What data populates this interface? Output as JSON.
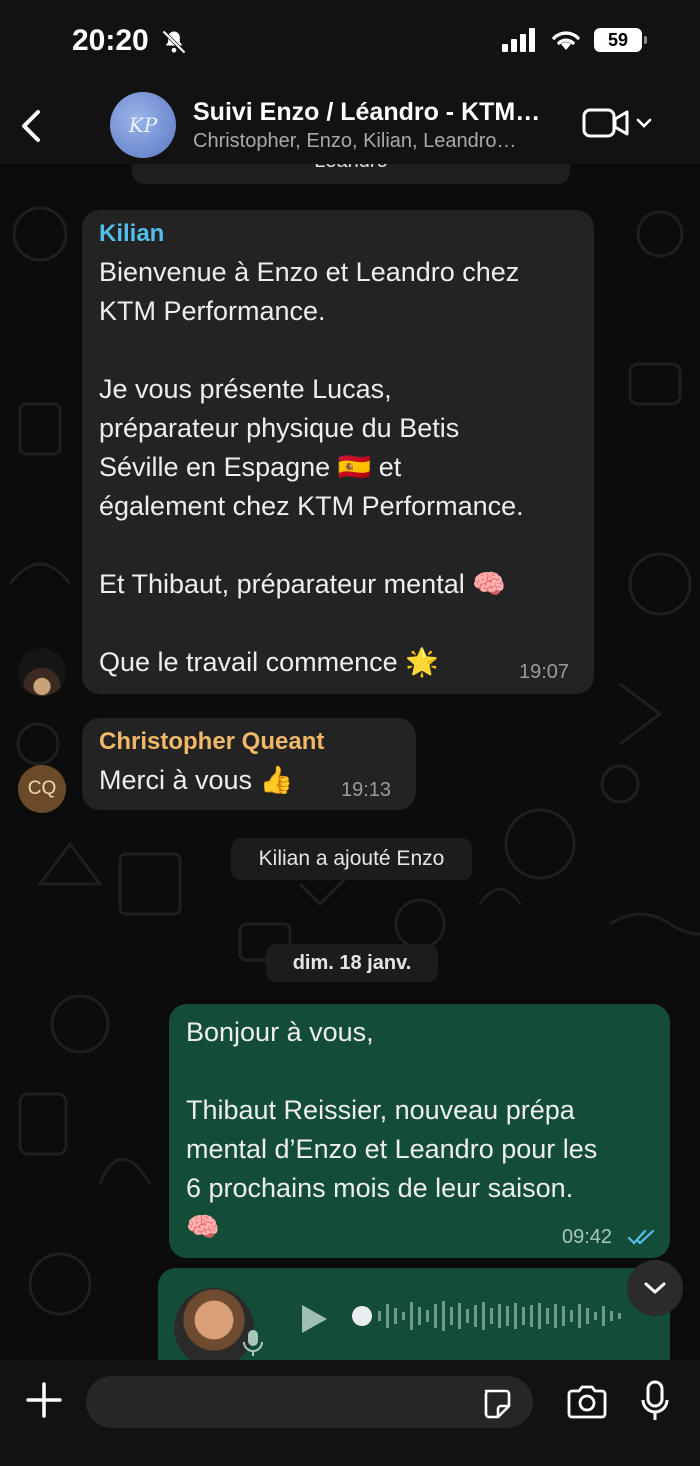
{
  "status": {
    "time": "20:20",
    "battery": "59"
  },
  "header": {
    "title": "Suivi Enzo / Léandro - KTM…",
    "subtitle": "Christopher, Enzo, Kilian, Leandro…",
    "avatar_text": "KP"
  },
  "messages": {
    "clipped_name": "Leandro",
    "kilian": {
      "sender": "Kilian",
      "sender_color": "#53bdeb",
      "text": "Bienvenue à Enzo et Leandro chez\nKTM Performance.\n\nJe vous présente Lucas,\npréparateur physique du Betis\nSéville en Espagne 🇪🇸 et\négalement chez KTM Performance.\n\nEt Thibaut, préparateur mental 🧠\n\nQue le travail commence 🌟",
      "time": "19:07"
    },
    "christopher": {
      "sender": "Christopher Queant",
      "sender_color": "#f0b867",
      "initials": "CQ",
      "text": "Merci à vous 👍",
      "time": "19:13"
    },
    "system_added": "Kilian a ajouté Enzo",
    "date_divider": "dim. 18 janv.",
    "outgoing": {
      "text": "Bonjour à vous,\n\nThibaut Reissier, nouveau prépa\nmental d’Enzo et Leandro pour les\n6 prochains mois de leur saison.\n🧠",
      "time": "09:42",
      "read_color": "#53bdeb"
    }
  },
  "composer": {
    "placeholder": ""
  },
  "icons": [
    "bell-off-icon",
    "signal-icon",
    "wifi-icon",
    "battery-icon",
    "back-icon",
    "video-call-icon",
    "chevron-down-icon",
    "play-icon",
    "mic-icon",
    "plus-icon",
    "sticker-icon",
    "camera-icon",
    "double-check-icon"
  ]
}
